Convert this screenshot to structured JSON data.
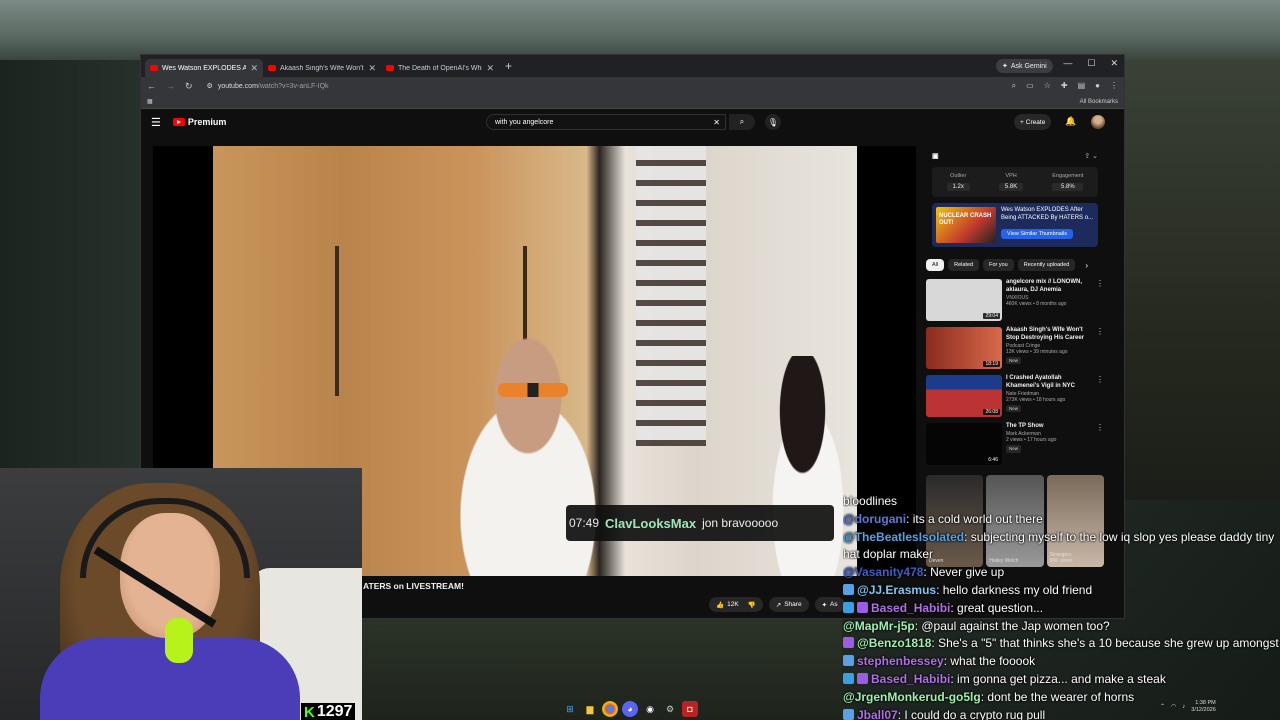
{
  "browser": {
    "tabs": [
      {
        "title": "Wes Watson EXPLODES After B",
        "active": true
      },
      {
        "title": "Akaash Singh's Wife Won't Sto",
        "active": false
      },
      {
        "title": "The Death of OpenAI's Whistl",
        "active": false
      }
    ],
    "ask_gemini": "Ask Gemini",
    "url_host": "youtube.com",
    "url_path": "/watch?v=3v-anLF-IQk",
    "all_bookmarks": "All Bookmarks"
  },
  "youtube": {
    "logo_label": "Premium",
    "search_value": "with you angelcore",
    "create_label": "Create",
    "video_title": "ATERS on LIVESTREAM!",
    "likes": "12K",
    "share_label": "Share",
    "ask_label": "As"
  },
  "extension": {
    "stats": [
      {
        "label": "Outlier",
        "value": "1.2x"
      },
      {
        "label": "VPH",
        "value": "5.8K"
      },
      {
        "label": "Engagement",
        "value": "5.8%"
      }
    ],
    "card_title": "Wes Watson EXPLODES After Being ATTACKED By HATERS o...",
    "card_button": "View Similar Thumbnails",
    "thumb_text": "NUCLEAR CRASH OUT!"
  },
  "chips": [
    "All",
    "Related",
    "For you",
    "Recently uploaded"
  ],
  "related": [
    {
      "title": "angelcore mix // LONOWN, aklaura, DJ Anemia",
      "channel": "VNXIOUS",
      "meta": "460K views • 8 months ago",
      "duration": "29:04",
      "new": "",
      "color": "#d8d8d8"
    },
    {
      "title": "Akaash Singh's Wife Won't Stop Destroying His Career",
      "channel": "Podcast Cringe",
      "meta": "13K views • 39 minutes ago",
      "duration": "18:19",
      "new": "New",
      "color": "#8a2b1f"
    },
    {
      "title": "I Crashed Ayatollah Khamenei's Vigil in NYC",
      "channel": "Nate Friedman",
      "meta": "273K views • 18 hours ago",
      "duration": "26:08",
      "new": "New",
      "color": "#1d3b8c"
    },
    {
      "title": "The TP Show",
      "channel": "Mark Ackerman",
      "meta": "2 views • 17 hours ago",
      "duration": "6:46",
      "new": "New",
      "color": "#050505"
    }
  ],
  "shorts": [
    "Deven",
    "Hailey Welch",
    "Strangers"
  ],
  "shorts_views": "99K views",
  "stream": {
    "kick_count": "1297",
    "highlight": {
      "time": "07:49",
      "user": "ClavLooksMax",
      "text": "jon bravooooo"
    }
  },
  "chat": [
    {
      "user": "",
      "text": "bloodlines",
      "color": "#ffffff"
    },
    {
      "user": "@dorugani",
      "text": "its a cold world out there",
      "color": "#5b7bd6"
    },
    {
      "user": "@TheBeatlesIsolated",
      "text": "subjecting myself to the low iq slop yes please daddy tiny hat doplar maker",
      "color": "#4fa3e6"
    },
    {
      "user": "@Vasanity478",
      "text": "Never give up",
      "color": "#3d5ec9"
    },
    {
      "user": "@JJ.Erasmus",
      "text": "hello darkness my old friend",
      "color": "#7ec8f0"
    },
    {
      "user": "Based_Habibi",
      "text": "great question...",
      "color": "#b06ee8"
    },
    {
      "user": "@MapMr-j5p",
      "text": "@paul against the Jap women too?",
      "color": "#9ef0b0"
    },
    {
      "user": "@Benzo1818",
      "text": "She's a \"5\" that thinks she's a 10 because she grew up amongst 3's",
      "color": "#9ef0b0"
    },
    {
      "user": "stephenbessey",
      "text": "what the fooook",
      "color": "#b06ee8"
    },
    {
      "user": "Based_Habibi",
      "text": "im gonna get pizza... and make a steak",
      "color": "#b06ee8"
    },
    {
      "user": "@JrgenMonkerud-go5lg",
      "text": "dont be the wearer of horns",
      "color": "#9ef0b0"
    },
    {
      "user": "Jball07",
      "text": "I could do a crypto rug pull",
      "color": "#b06ee8"
    }
  ],
  "taskbar": {
    "time": "1:38 PM",
    "date": "3/12/2026"
  }
}
